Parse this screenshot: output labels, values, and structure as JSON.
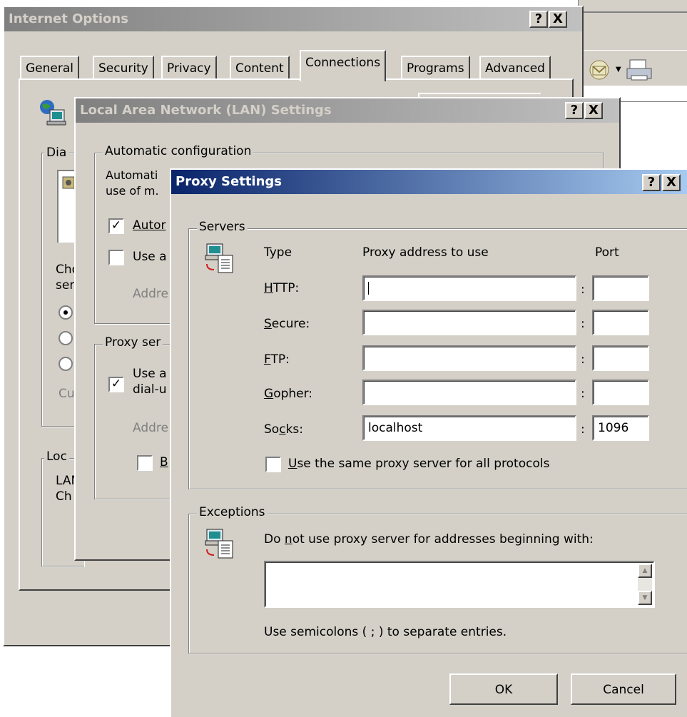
{
  "internet_options": {
    "title": "Internet Options",
    "help_glyph": "?",
    "close_glyph": "X",
    "tabs": [
      "General",
      "Security",
      "Privacy",
      "Content",
      "Connections",
      "Programs",
      "Advanced"
    ],
    "active_tab": "Connections",
    "partial": {
      "dial": "Dia",
      "cho": "Cho",
      "ser": "ser",
      "cu": "Cu",
      "loc": "Loc",
      "lan": "LAN",
      "chi": "Ch"
    }
  },
  "lan_settings": {
    "title": "Local Area Network (LAN) Settings",
    "help_glyph": "?",
    "close_glyph": "X",
    "auto_config_legend": "Automatic configuration",
    "auto_line1": "Automati",
    "auto_line2": "use of m.",
    "autodetect_label": "Autor",
    "use_script_label": "Use a",
    "address_label": "Addre",
    "proxy_legend": "Proxy ser",
    "use_proxy_line1": "Use a",
    "use_proxy_line2": "dial-u",
    "proxy_address_label": "Addre",
    "bypass_label": "B"
  },
  "proxy_settings": {
    "title": "Proxy Settings",
    "help_glyph": "?",
    "close_glyph": "X",
    "servers_legend": "Servers",
    "col_type": "Type",
    "col_address": "Proxy address to use",
    "col_port": "Port",
    "rows": [
      {
        "label_key": "H",
        "label_rest": "TTP:",
        "address": "",
        "port": ""
      },
      {
        "label_key": "S",
        "label_rest": "ecure:",
        "address": "",
        "port": ""
      },
      {
        "label_key": "F",
        "label_rest": "TP:",
        "address": "",
        "port": ""
      },
      {
        "label_key": "G",
        "label_rest": "opher:",
        "address": "",
        "port": ""
      },
      {
        "label_pre": "So",
        "label_key": "c",
        "label_rest": "ks:",
        "address": "localhost",
        "port": "1096"
      }
    ],
    "colon": ":",
    "same_proxy_key": "U",
    "same_proxy_rest": "se the same proxy server for all protocols",
    "exceptions_legend": "Exceptions",
    "exceptions_desc_pre": "Do ",
    "exceptions_desc_key": "n",
    "exceptions_desc_rest": "ot use proxy server for addresses beginning with:",
    "exceptions_value": "",
    "exceptions_hint": "Use semicolons ( ; ) to separate entries.",
    "ok_label": "OK",
    "cancel_label": "Cancel"
  },
  "colors": {
    "face": "#d4d0c8",
    "active_title": "#0a246a",
    "inactive_title": "#808080"
  }
}
